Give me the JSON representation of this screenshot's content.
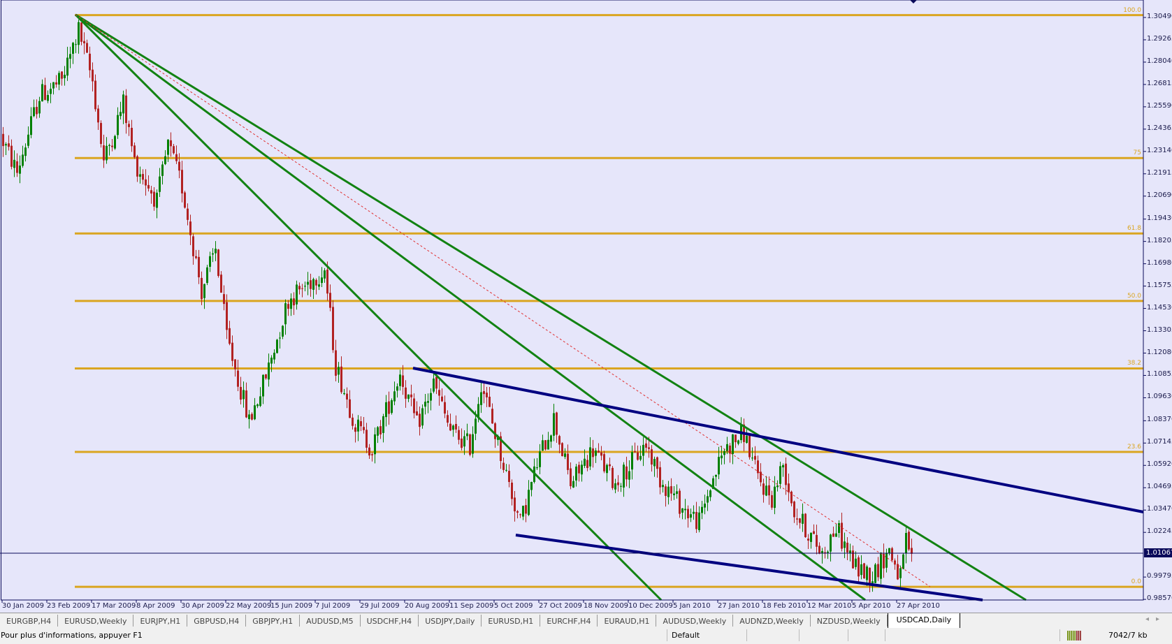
{
  "window": {
    "symbol_tab_active": "USDCAD,Daily"
  },
  "tabs": [
    "EURGBP,H4",
    "EURUSD,Weekly",
    "EURJPY,H1",
    "GBPUSD,H4",
    "GBPJPY,H1",
    "AUDUSD,M5",
    "USDCHF,H4",
    "USDJPY,Daily",
    "EURUSD,H1",
    "EURCHF,H4",
    "EURAUD,H1",
    "AUDUSD,Weekly",
    "AUDNZD,Weekly",
    "NZDUSD,Weekly",
    "USDCAD,Daily"
  ],
  "active_tab_index": 14,
  "status": {
    "help": "Pour plus d'informations, appuyer F1",
    "profile": "Default",
    "traffic": "7042/7 kb"
  },
  "colors": {
    "background": "#e6e6fa",
    "bull": "#008000",
    "bear": "#b22222",
    "fib": "#daa520",
    "fan": "#128212",
    "channel": "#000080",
    "axis": "#0a0a5a"
  },
  "chart_data": {
    "type": "candlestick",
    "symbol": "USDCAD",
    "timeframe": "Daily",
    "current_price": "1.01067",
    "price_ticks": [
      "1.30490",
      "1.29265",
      "1.28040",
      "1.26815",
      "1.25590",
      "1.24365",
      "1.23140",
      "1.21915",
      "1.20690",
      "1.19430",
      "1.18205",
      "1.16980",
      "1.15755",
      "1.14530",
      "1.13305",
      "1.12080",
      "1.10855",
      "1.09630",
      "1.08370",
      "1.07145",
      "1.05920",
      "1.04695",
      "1.03470",
      "1.02245",
      "0.99795",
      "0.98570"
    ],
    "ylim": [
      0.9857,
      1.3049
    ],
    "date_ticks": [
      "30 Jan 2009",
      "23 Feb 2009",
      "17 Mar 2009",
      "8 Apr 2009",
      "30 Apr 2009",
      "22 May 2009",
      "15 Jun 2009",
      "7 Jul 2009",
      "29 Jul 2009",
      "20 Aug 2009",
      "11 Sep 2009",
      "5 Oct 2009",
      "27 Oct 2009",
      "18 Nov 2009",
      "10 Dec 2009",
      "5 Jan 2010",
      "27 Jan 2010",
      "18 Feb 2010",
      "12 Mar 2010",
      "5 Apr 2010",
      "27 Apr 2010"
    ],
    "bars_per_date_tick": 16,
    "close_waypoints": [
      [
        0,
        1.2367
      ],
      [
        5,
        1.22
      ],
      [
        13,
        1.262
      ],
      [
        21,
        1.27
      ],
      [
        27,
        1.298
      ],
      [
        32,
        1.27
      ],
      [
        36,
        1.226
      ],
      [
        43,
        1.258
      ],
      [
        47,
        1.226
      ],
      [
        55,
        1.204
      ],
      [
        59,
        1.235
      ],
      [
        64,
        1.212
      ],
      [
        71,
        1.155
      ],
      [
        76,
        1.178
      ],
      [
        80,
        1.13
      ],
      [
        88,
        1.083
      ],
      [
        94,
        1.108
      ],
      [
        102,
        1.15
      ],
      [
        115,
        1.167
      ],
      [
        119,
        1.114
      ],
      [
        126,
        1.082
      ],
      [
        132,
        1.068
      ],
      [
        142,
        1.11
      ],
      [
        148,
        1.081
      ],
      [
        154,
        1.104
      ],
      [
        160,
        1.078
      ],
      [
        167,
        1.07
      ],
      [
        171,
        1.105
      ],
      [
        179,
        1.06
      ],
      [
        185,
        1.027
      ],
      [
        191,
        1.06
      ],
      [
        197,
        1.085
      ],
      [
        203,
        1.049
      ],
      [
        211,
        1.068
      ],
      [
        219,
        1.049
      ],
      [
        230,
        1.071
      ],
      [
        235,
        1.052
      ],
      [
        243,
        1.036
      ],
      [
        249,
        1.028
      ],
      [
        253,
        1.048
      ],
      [
        258,
        1.068
      ],
      [
        265,
        1.077
      ],
      [
        270,
        1.052
      ],
      [
        275,
        1.041
      ],
      [
        279,
        1.06
      ],
      [
        283,
        1.034
      ],
      [
        293,
        1.011
      ],
      [
        298,
        1.025
      ],
      [
        305,
        1.003
      ],
      [
        311,
        0.999
      ],
      [
        317,
        1.013
      ],
      [
        321,
        0.997
      ],
      [
        323,
        1.017
      ],
      [
        325,
        1.0107
      ]
    ],
    "fibonacci": {
      "high": 1.3062,
      "low": 0.9926,
      "levels": [
        {
          "ratio": 1.0,
          "label": "100.0"
        },
        {
          "ratio": 0.75,
          "label": "75"
        },
        {
          "ratio": 0.618,
          "label": "61.8"
        },
        {
          "ratio": 0.5,
          "label": "50.0"
        },
        {
          "ratio": 0.382,
          "label": "38.2"
        },
        {
          "ratio": 0.236,
          "label": "23.6"
        },
        {
          "ratio": 0.0,
          "label": "0.0"
        }
      ]
    }
  }
}
